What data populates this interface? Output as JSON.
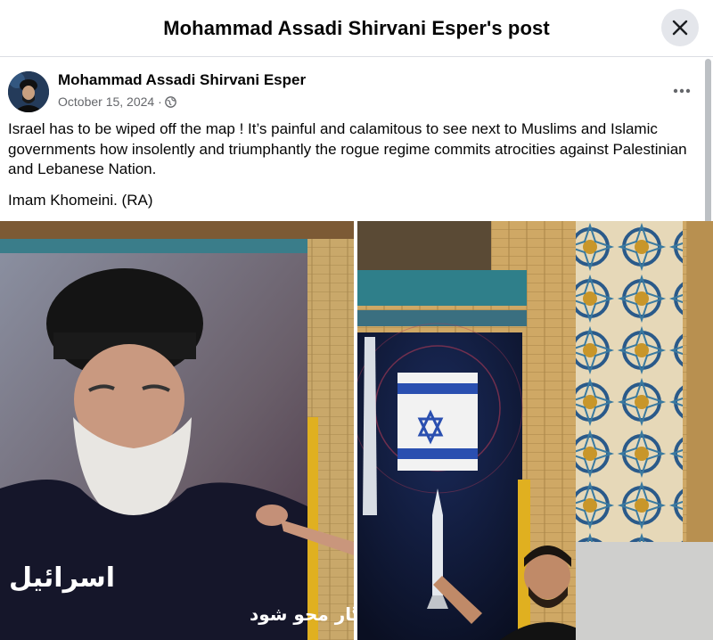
{
  "header": {
    "title": "Mohammad Assadi Shirvani Esper's post"
  },
  "post": {
    "author": "Mohammad Assadi Shirvani Esper",
    "date": "October 15, 2024 ·",
    "privacy_icon": "globe-icon",
    "body": [
      "Israel has to be wiped off the map ! It’s painful and calamitous to see next to Muslims and Islamic governments how insolently and triumphantly the rogue regime commits atrocities against Palestinian and Lebanese Nation.",
      "Imam Khomeini. (RA)"
    ]
  },
  "photos": {
    "left_banner_text": "باید از صفحه روزگار محو شود",
    "left_logo_text": "اسرائیل"
  },
  "colors": {
    "accent": "#e4e6eb",
    "secondary_text": "#65676b"
  }
}
